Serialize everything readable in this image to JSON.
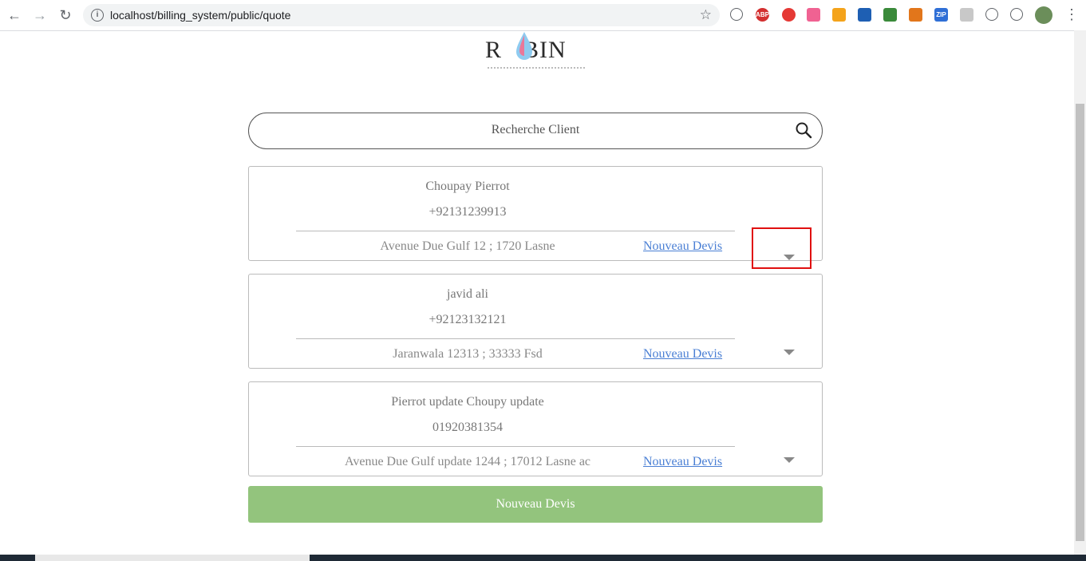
{
  "browser": {
    "url": "localhost/billing_system/public/quote",
    "extensions": [
      {
        "name": "extension-icon",
        "color": "#5f6368"
      },
      {
        "name": "adblock-icon",
        "label": "ABP",
        "color": "#d32f2f"
      },
      {
        "name": "opera-icon",
        "color": "#e53935"
      },
      {
        "name": "arrow-extension-icon",
        "color": "#f06292"
      },
      {
        "name": "orange-extension-icon",
        "color": "#f4a31b"
      },
      {
        "name": "download-extension-icon",
        "color": "#1e5fb3"
      },
      {
        "name": "globe-extension-icon",
        "color": "#3a8a3a"
      },
      {
        "name": "metamask-icon",
        "color": "#e2761b"
      },
      {
        "name": "zip-extension-icon",
        "label": "ZIP",
        "color": "#2f6fd6"
      },
      {
        "name": "grey-extension-icon",
        "color": "#c8c8c8"
      },
      {
        "name": "c-extension-icon",
        "color": "#5f6368"
      },
      {
        "name": "puzzle-icon",
        "color": "#5f6368"
      }
    ]
  },
  "logo": {
    "text": "RBIN",
    "left": "R",
    "right": "BIN"
  },
  "search": {
    "placeholder": "Recherche Client"
  },
  "clients": [
    {
      "name": "Choupay Pierrot",
      "phone": "+92131239913",
      "address": "Avenue Due Gulf 12 ; 1720 Lasne",
      "link": "Nouveau Devis"
    },
    {
      "name": "javid ali",
      "phone": "+92123132121",
      "address": "Jaranwala 12313 ; 33333 Fsd",
      "link": "Nouveau Devis"
    },
    {
      "name": "Pierrot update Choupy update",
      "phone": "01920381354",
      "address": "Avenue Due Gulf update 1244 ; 17012 Lasne ac",
      "link": "Nouveau Devis"
    }
  ],
  "submit": {
    "label": "Nouveau Devis",
    "color": "#93c47d"
  },
  "colors": {
    "highlight": "#e01010",
    "link": "#4a7fd4"
  }
}
